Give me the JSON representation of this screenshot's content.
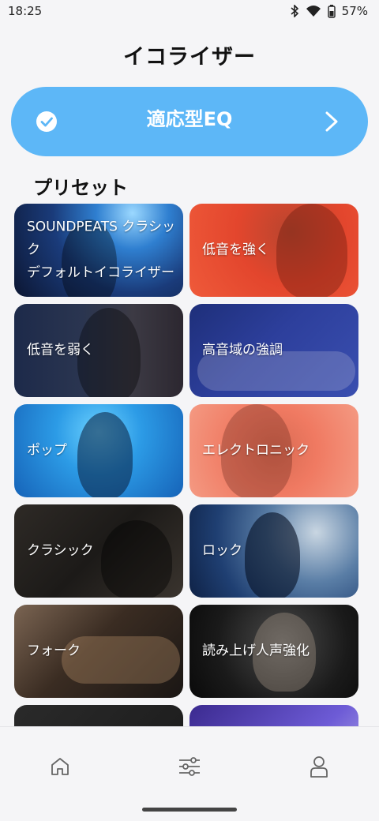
{
  "status": {
    "time": "18:25",
    "battery": "57%"
  },
  "page": {
    "title": "イコライザー"
  },
  "eq_card": {
    "label": "適応型EQ",
    "checked": true
  },
  "presets": {
    "section_title": "プリセット",
    "items": [
      {
        "label": "SOUNDPEATS クラシック",
        "sub": "デフォルトイコライザー"
      },
      {
        "label": "低音を強く"
      },
      {
        "label": "低音を弱く"
      },
      {
        "label": "高音域の強調"
      },
      {
        "label": "ポップ"
      },
      {
        "label": "エレクトロニック"
      },
      {
        "label": "クラシック"
      },
      {
        "label": "ロック"
      },
      {
        "label": "フォーク"
      },
      {
        "label": "読み上げ人声強化"
      }
    ]
  },
  "nav": {
    "items": [
      "home-icon",
      "equalizer-icon",
      "profile-icon"
    ]
  }
}
